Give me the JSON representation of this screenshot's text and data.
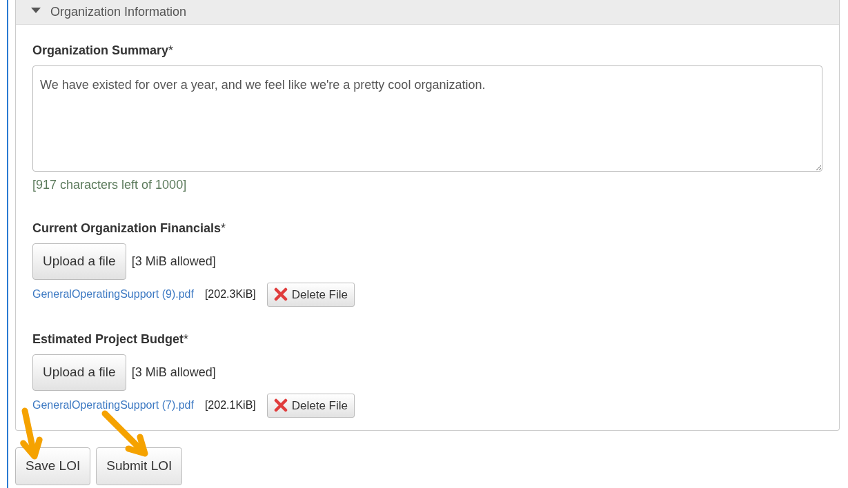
{
  "panel": {
    "title": "Organization Information",
    "expanded": true
  },
  "summary": {
    "label": "Organization Summary",
    "required_mark": "*",
    "value": "We have existed for over a year, and we feel like we're a pretty cool organization.",
    "counter": "[917 characters left of 1000]"
  },
  "uploads": [
    {
      "label": "Current Organization Financials",
      "required_mark": "*",
      "button": "Upload a file",
      "limit": "[3 MiB allowed]",
      "file": {
        "name": "GeneralOperatingSupport (9).pdf",
        "size": "[202.3KiB]",
        "delete": "Delete File"
      }
    },
    {
      "label": "Estimated Project Budget",
      "required_mark": "*",
      "button": "Upload a file",
      "limit": "[3 MiB allowed]",
      "file": {
        "name": "GeneralOperatingSupport (7).pdf",
        "size": "[202.1KiB]",
        "delete": "Delete File"
      }
    }
  ],
  "actions": [
    "Save LOI",
    "Submit LOI"
  ],
  "arrows": [
    {
      "kind": "down"
    },
    {
      "kind": "down-right"
    }
  ]
}
